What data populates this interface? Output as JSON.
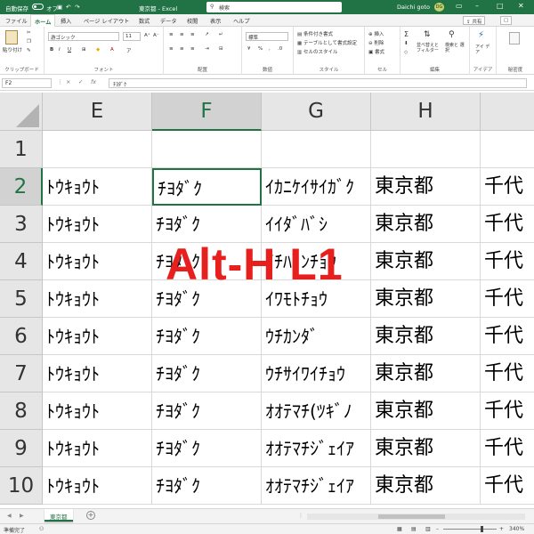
{
  "titlebar": {
    "autosave_label": "自動保存",
    "toggle_state": "オフ",
    "workbook_title": "東京都 - Excel",
    "search_placeholder": "検索",
    "user_name": "Daichi goto",
    "user_initials": "DG"
  },
  "ribbon_tabs": {
    "items": [
      "ファイル",
      "ホーム",
      "挿入",
      "ページ レイアウト",
      "数式",
      "データ",
      "校閲",
      "表示",
      "ヘルプ"
    ],
    "active": "ホーム",
    "share_label": "共有",
    "comment_label": "コメント"
  },
  "ribbon": {
    "clipboard": {
      "label": "クリップボード",
      "paste": "貼り付け"
    },
    "font": {
      "label": "フォント",
      "font_name": "游ゴシック",
      "font_size": "11",
      "bold": "B",
      "italic": "I",
      "underline": "U"
    },
    "alignment": {
      "label": "配置"
    },
    "number": {
      "label": "数値",
      "format": "標準"
    },
    "styles": {
      "label": "スタイル",
      "conditional": "条件付き書式",
      "table": "テーブルとして書式設定",
      "cell_styles": "セルのスタイル"
    },
    "cells": {
      "label": "セル",
      "insert": "挿入",
      "delete": "削除",
      "format": "書式"
    },
    "editing": {
      "label": "編集",
      "sort": "並べ替えと フィルター",
      "find": "検索と 選択"
    },
    "ideas": {
      "label": "アイデア",
      "text": "アイ デア"
    },
    "sensitivity": {
      "label": "秘密度"
    }
  },
  "formula_bar": {
    "name_box": "F2",
    "cancel": "×",
    "enter": "✓",
    "fx": "fx",
    "content": "ﾁﾖﾀﾞｸ"
  },
  "grid": {
    "column_headers": [
      "E",
      "F",
      "G",
      "H",
      ""
    ],
    "selected_column": "F",
    "row_headers": [
      "1",
      "2",
      "3",
      "4",
      "5",
      "6",
      "7",
      "8",
      "9",
      "10"
    ],
    "selected_row": "2",
    "active_cell": "F2",
    "rows": [
      [
        "",
        "",
        "",
        "",
        ""
      ],
      [
        "ﾄｳｷｮｳﾄ",
        "ﾁﾖﾀﾞｸ",
        "ｲｶﾆｹｲｻｲｶﾞｸ",
        "東京都",
        "千代"
      ],
      [
        "ﾄｳｷｮｳﾄ",
        "ﾁﾖﾀﾞｸ",
        "ｲｲﾀﾞﾊﾞｼ",
        "東京都",
        "千代"
      ],
      [
        "ﾄｳｷｮｳﾄ",
        "ﾁﾖﾀﾞｸ",
        "ｲﾁﾊﾞﾝﾁｮｳ",
        "東京都",
        "千代"
      ],
      [
        "ﾄｳｷｮｳﾄ",
        "ﾁﾖﾀﾞｸ",
        "ｲﾜﾓﾄﾁｮｳ",
        "東京都",
        "千代"
      ],
      [
        "ﾄｳｷｮｳﾄ",
        "ﾁﾖﾀﾞｸ",
        "ｳﾁｶﾝﾀﾞ",
        "東京都",
        "千代"
      ],
      [
        "ﾄｳｷｮｳﾄ",
        "ﾁﾖﾀﾞｸ",
        "ｳﾁｻｲﾜｲﾁｮｳ",
        "東京都",
        "千代"
      ],
      [
        "ﾄｳｷｮｳﾄ",
        "ﾁﾖﾀﾞｸ",
        "ｵｵﾃﾏﾁ(ﾂｷﾞﾉ",
        "東京都",
        "千代"
      ],
      [
        "ﾄｳｷｮｳﾄ",
        "ﾁﾖﾀﾞｸ",
        "ｵｵﾃﾏﾁｼﾞｪｲｱ",
        "東京都",
        "千代"
      ],
      [
        "ﾄｳｷｮｳﾄ",
        "ﾁﾖﾀﾞｸ",
        "ｵｵﾃﾏﾁｼﾞｪｲｱ",
        "東京都",
        "千代"
      ]
    ]
  },
  "overlay": {
    "text": "Alt-H L1",
    "color": "#e8201d"
  },
  "sheet_tabs": {
    "active": "東京都",
    "add": "+"
  },
  "statusbar": {
    "status": "準備完了",
    "zoom": "340%"
  },
  "colors": {
    "accent": "#217346",
    "header_bg": "#e6e6e6",
    "selected_header_bg": "#d2d2d2"
  }
}
